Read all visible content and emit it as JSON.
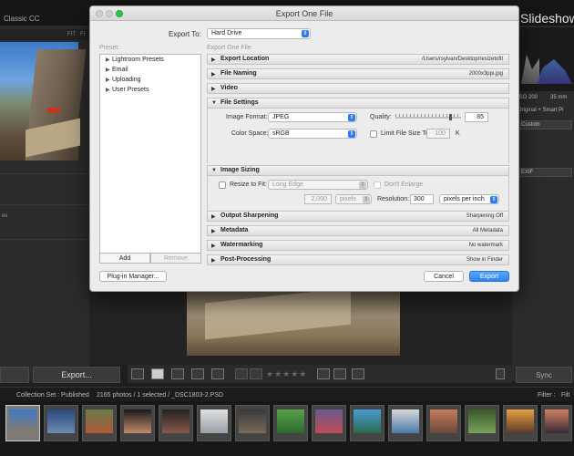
{
  "app": {
    "title": "Classic CC",
    "module": "Slideshow",
    "left_panel": {
      "navigator_labels": [
        "FIT",
        "FI"
      ],
      "presets_label": "es",
      "export_button": "Export..."
    },
    "right_panel": {
      "iso": "ISO 200",
      "focal": "35 mm",
      "original": "Original + Smart Pi",
      "custom": "Custom",
      "exif": "EXIF",
      "sync_button": "Sync"
    },
    "filmstrip": {
      "collection": "Collection Set : Published",
      "count": "2165 photos / 1 selected / _DSC1803-2.PSD",
      "filter_label": "Filter :",
      "filter_value": "Filt"
    },
    "toolbar": {
      "stars": "★★★★★"
    }
  },
  "dialog": {
    "title": "Export One File",
    "export_to_label": "Export To:",
    "export_to_value": "Hard Drive",
    "preset_label": "Preset:",
    "subtitle": "Export One File",
    "presets": [
      "Lightroom Presets",
      "Email",
      "Uploading",
      "User Presets"
    ],
    "add_button": "Add",
    "remove_button": "Remove",
    "plugin_button": "Plug-in Manager...",
    "cancel_button": "Cancel",
    "export_button": "Export",
    "sections": {
      "export_location": {
        "title": "Export Location",
        "summary": "/Users/rsylvan/Desktop/resizetofit"
      },
      "file_naming": {
        "title": "File Naming",
        "summary": "2000x3ppi.jpg"
      },
      "video": {
        "title": "Video",
        "summary": ""
      },
      "file_settings": {
        "title": "File Settings",
        "image_format_label": "Image Format:",
        "image_format": "JPEG",
        "quality_label": "Quality:",
        "quality": "85",
        "quality_fraction": 0.85,
        "color_space_label": "Color Space:",
        "color_space": "sRGB",
        "limit_label": "Limit File Size To:",
        "limit_value": "100",
        "limit_unit": "K"
      },
      "image_sizing": {
        "title": "Image Sizing",
        "resize_label": "Resize to Fit:",
        "resize_value": "Long Edge",
        "dont_enlarge": "Don't Enlarge",
        "size_value": "2,000",
        "size_unit": "pixels",
        "resolution_label": "Resolution:",
        "resolution": "300",
        "resolution_unit": "pixels per inch"
      },
      "output_sharpening": {
        "title": "Output Sharpening",
        "summary": "Sharpening Off"
      },
      "metadata": {
        "title": "Metadata",
        "summary": "All Metadata"
      },
      "watermarking": {
        "title": "Watermarking",
        "summary": "No watermark"
      },
      "post_processing": {
        "title": "Post-Processing",
        "summary": "Show in Finder"
      }
    }
  }
}
